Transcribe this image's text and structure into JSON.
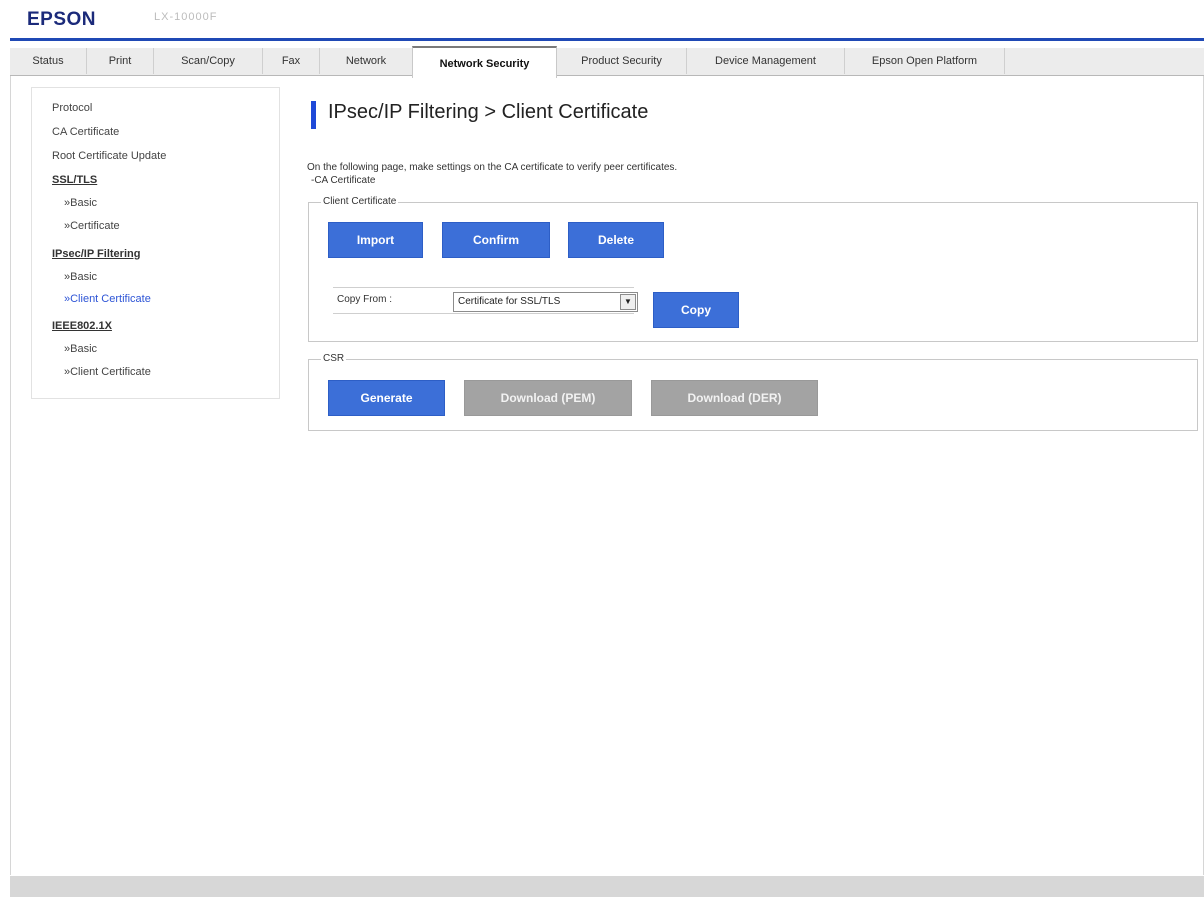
{
  "header": {
    "brand": "EPSON",
    "model": "LX-10000F"
  },
  "tabs": [
    {
      "label": "Status"
    },
    {
      "label": "Print"
    },
    {
      "label": "Scan/Copy"
    },
    {
      "label": "Fax"
    },
    {
      "label": "Network"
    },
    {
      "label": "Network Security",
      "active": true
    },
    {
      "label": "Product Security"
    },
    {
      "label": "Device Management"
    },
    {
      "label": "Epson Open Platform"
    }
  ],
  "sidebar": {
    "items": [
      {
        "label": "Protocol"
      },
      {
        "label": "CA Certificate"
      },
      {
        "label": "Root Certificate Update"
      },
      {
        "label": "SSL/TLS"
      },
      {
        "label": "»Basic"
      },
      {
        "label": "»Certificate"
      },
      {
        "label": "IPsec/IP Filtering"
      },
      {
        "label": "»Basic"
      },
      {
        "label": "»Client Certificate",
        "active": true
      },
      {
        "label": "IEEE802.1X"
      },
      {
        "label": "»Basic"
      },
      {
        "label": "»Client Certificate"
      }
    ]
  },
  "main": {
    "title": "IPsec/IP Filtering > Client Certificate",
    "description": "On the following page, make settings on the CA certificate to verify peer certificates.",
    "description_link": "-CA Certificate",
    "client_certificate": {
      "legend": "Client Certificate",
      "import_label": "Import",
      "confirm_label": "Confirm",
      "delete_label": "Delete",
      "copy_from_label": "Copy From :",
      "copy_from_value": "Certificate for SSL/TLS",
      "copy_label": "Copy"
    },
    "csr": {
      "legend": "CSR",
      "generate_label": "Generate",
      "download_pem_label": "Download (PEM)",
      "download_der_label": "Download (DER)"
    }
  },
  "colors": {
    "accent": "#3c6fd8",
    "header_line": "#1f49b5",
    "disabled": "#a3a3a3",
    "active_link": "#2e55d6"
  },
  "icons": {
    "select_arrow": "dropdown-arrow-icon"
  }
}
